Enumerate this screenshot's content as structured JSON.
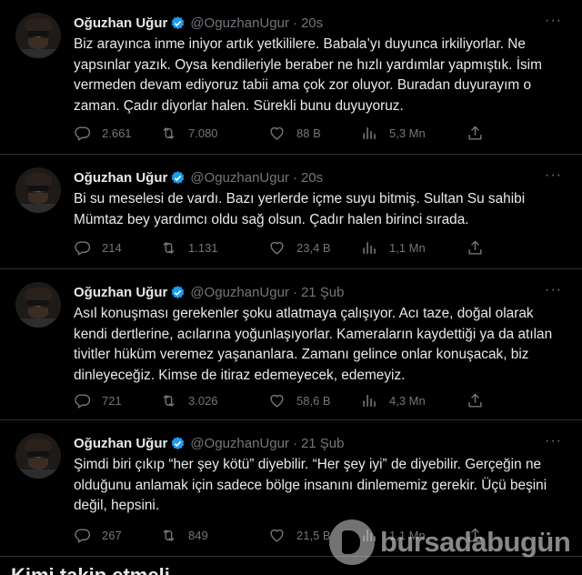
{
  "tweets": [
    {
      "name": "Oğuzhan Uğur",
      "handle": "@OguzhanUgur",
      "separator": "·",
      "time": "20s",
      "more": "···",
      "text": "Biz arayınca inme iniyor artık yetkililere. Babala’yı duyunca irkiliyorlar. Ne yapsınlar yazık. Oysa kendileriyle beraber ne hızlı yardımlar yapmıştık. İsim vermeden devam ediyoruz tabii ama çok zor oluyor. Buradan duyurayım o zaman. Çadır diyorlar halen. Sürekli bunu duyuyoruz.",
      "replies": "2.661",
      "retweets": "7.080",
      "likes": "88 B",
      "views": "5,3 Mn"
    },
    {
      "name": "Oğuzhan Uğur",
      "handle": "@OguzhanUgur",
      "separator": "·",
      "time": "20s",
      "more": "···",
      "text": "Bi su meselesi de vardı. Bazı yerlerde içme suyu bitmiş. Sultan Su sahibi Mümtaz bey yardımcı oldu sağ olsun. Çadır halen birinci sırada.",
      "replies": "214",
      "retweets": "1.131",
      "likes": "23,4 B",
      "views": "1,1 Mn"
    },
    {
      "name": "Oğuzhan Uğur",
      "handle": "@OguzhanUgur",
      "separator": "·",
      "time": "21 Şub",
      "more": "···",
      "text": "Asıl konuşması gerekenler şoku atlatmaya çalışıyor. Acı taze, doğal olarak kendi dertlerine, acılarına yoğunlaşıyorlar. Kameraların kaydettiği ya da atılan tivitler hüküm veremez yaşananlara. Zamanı gelince onlar konuşacak, biz dinleyeceğiz. Kimse de itiraz edemeyecek, edemeyiz.",
      "replies": "721",
      "retweets": "3.026",
      "likes": "58,6 B",
      "views": "4,3 Mn"
    },
    {
      "name": "Oğuzhan Uğur",
      "handle": "@OguzhanUgur",
      "separator": "·",
      "time": "21 Şub",
      "more": "···",
      "text": "Şimdi biri çıkıp “her şey kötü” diyebilir. “Her şey iyi” de diyebilir. Gerçeğin ne olduğunu anlamak için sadece bölge insanını dinlememiz gerekir. Üçü beşini değil, hepsini.",
      "replies": "267",
      "retweets": "849",
      "likes": "21,5 B",
      "views": "1,1 Mn"
    }
  ],
  "watermark": {
    "text": "bursadabugün"
  },
  "footer": {
    "text": "Kimi takip etmeli"
  },
  "colors": {
    "background": "#000000",
    "text": "#e7e9ea",
    "muted": "#71767b",
    "verified": "#1d9bf0",
    "divider": "#2f3336"
  },
  "icons": [
    "verified-badge-icon",
    "more-icon",
    "reply-icon",
    "retweet-icon",
    "like-icon",
    "views-icon",
    "share-icon"
  ]
}
